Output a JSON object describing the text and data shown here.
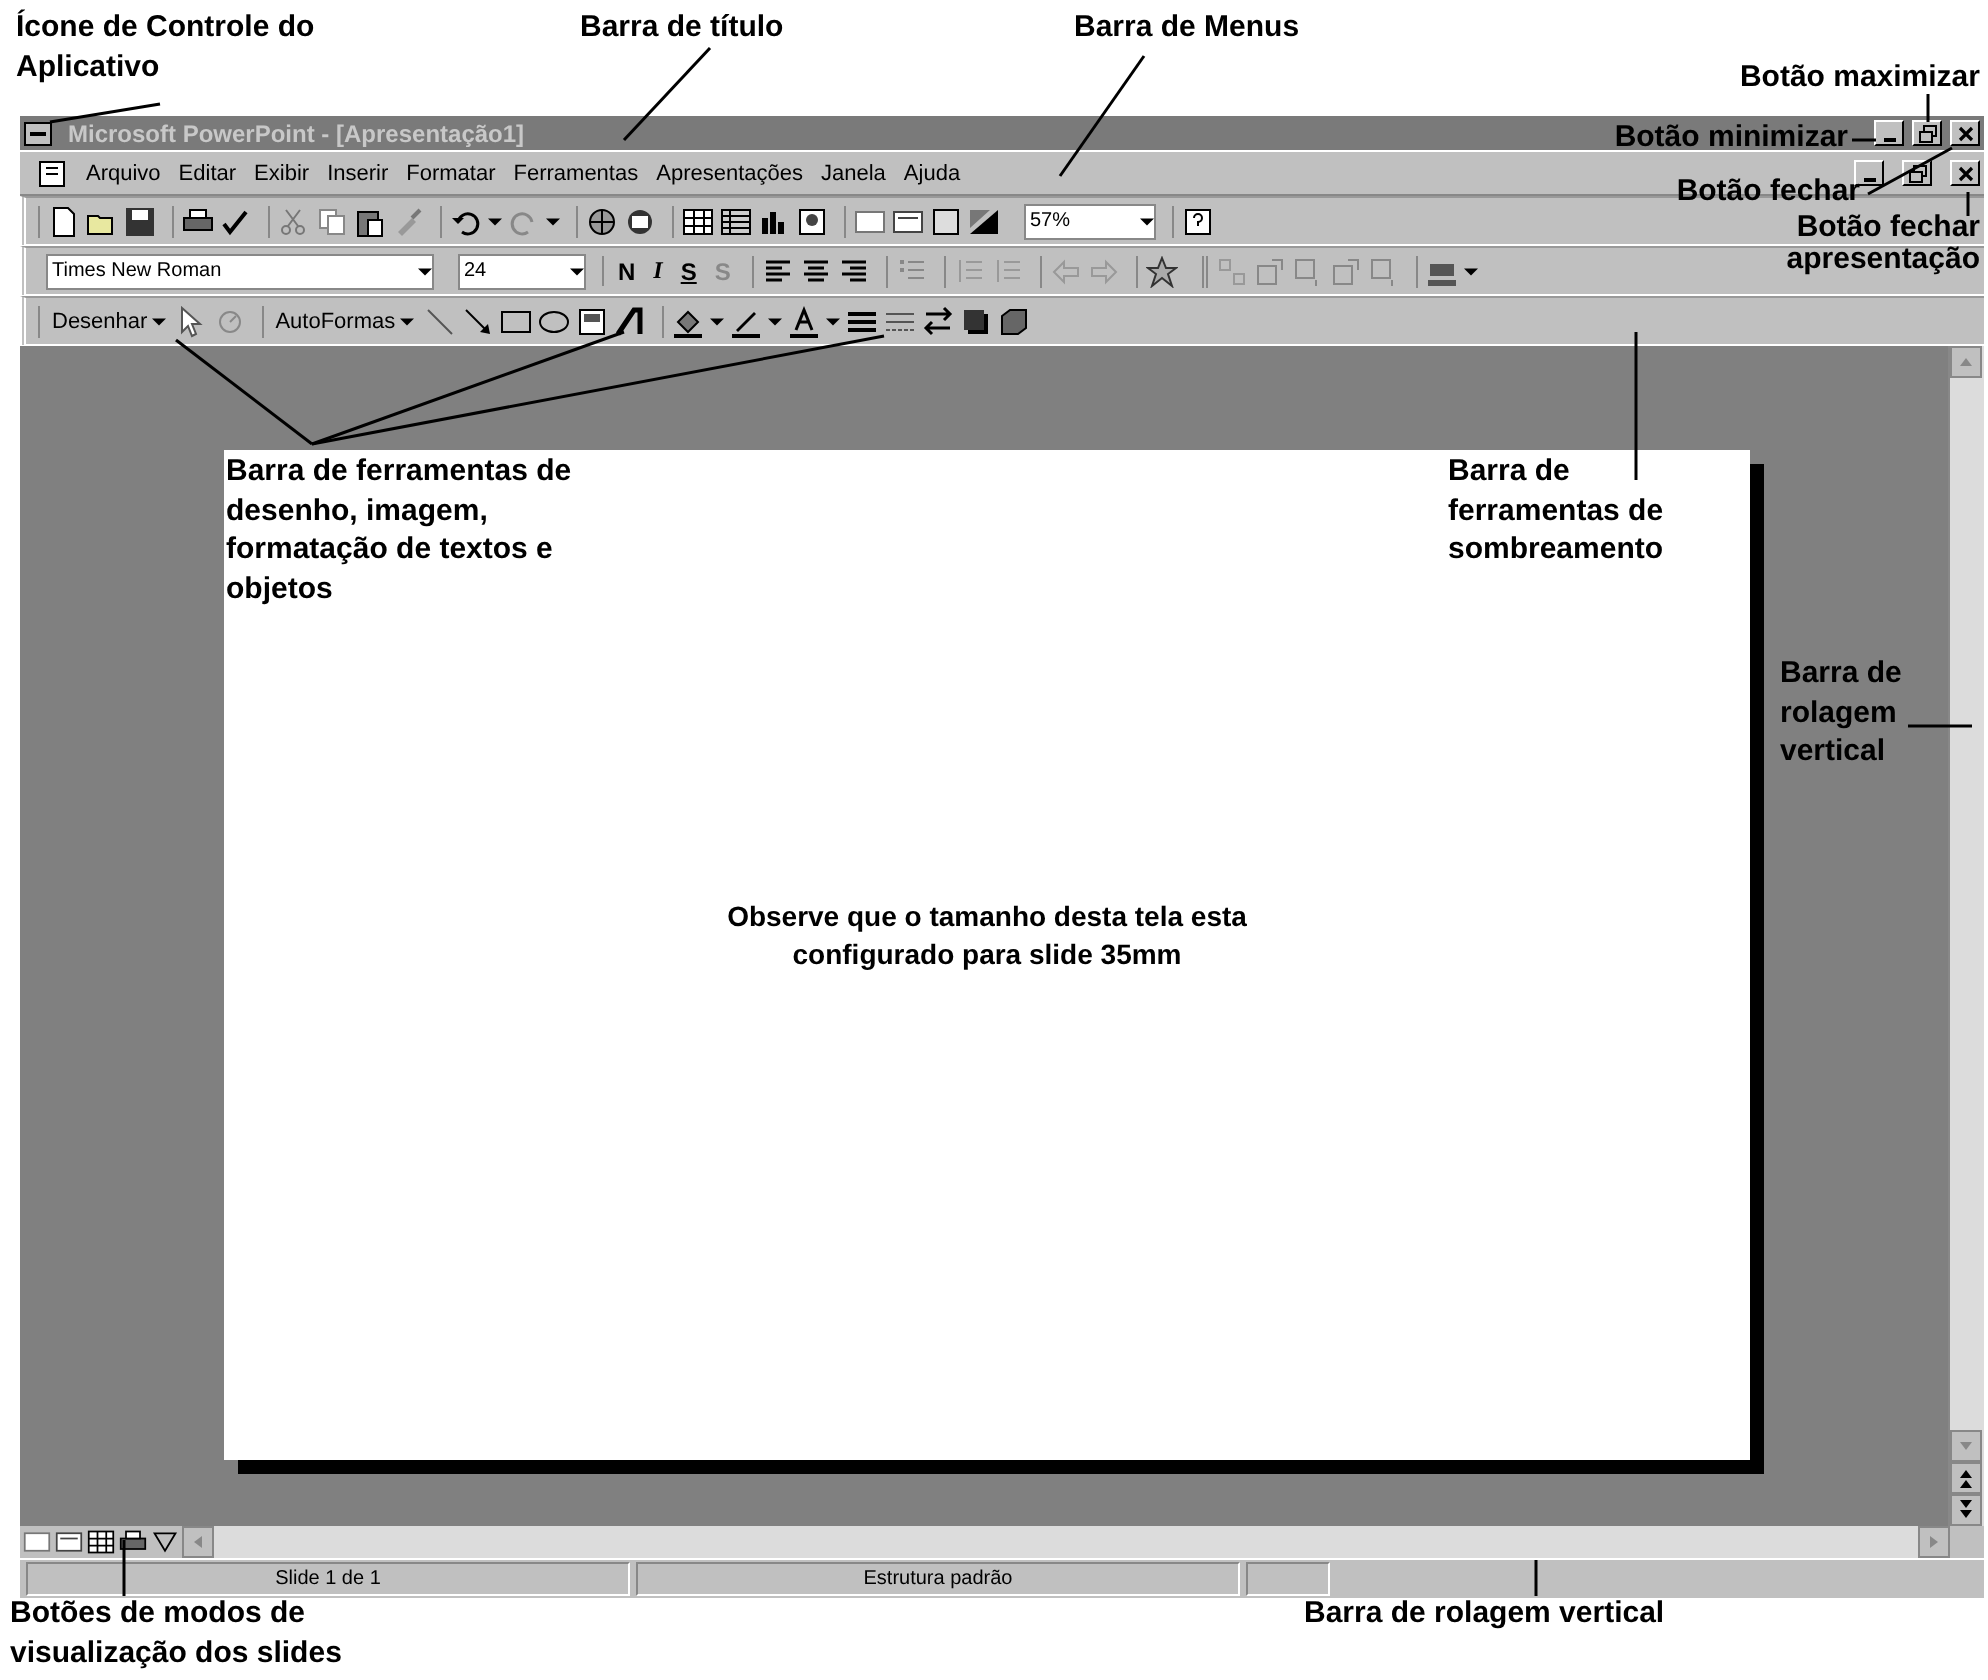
{
  "annotations": [
    {
      "text": "Ícone de Controle do Aplicativo"
    },
    {
      "text": "Barra de título"
    },
    {
      "text": "Barra de Menus"
    },
    {
      "text": "Botão maximizar"
    },
    {
      "text": "Botão minimizar"
    },
    {
      "text": "Botão fechar"
    },
    {
      "text": "Botão fechar apresentação"
    },
    {
      "text": "Barra de ferramentas de desenho, imagem, formatação de textos e objetos"
    },
    {
      "text": "Barra de ferramentas de sombreamento"
    },
    {
      "text": "Barra de rolagem vertical"
    },
    {
      "text": "Botões de modos de visualização dos slides"
    },
    {
      "text": "Barra de rolagem vertical"
    }
  ],
  "window": {
    "title": "Microsoft PowerPoint - [Apresentação1]"
  },
  "menu_bar": {
    "items": [
      "Arquivo",
      "Editar",
      "Exibir",
      "Inserir",
      "Formatar",
      "Ferramentas",
      "Apresentações",
      "Janela",
      "Ajuda"
    ]
  },
  "standard_toolbar": {
    "zoom": "57%"
  },
  "formatting_toolbar": {
    "font": "Times New Roman",
    "size": "24",
    "style_buttons": [
      "N",
      "I",
      "S",
      "S"
    ]
  },
  "drawing_toolbar": {
    "draw_menu": "Desenhar",
    "autoshapes_menu": "AutoFormas"
  },
  "slide": {
    "text": "Observe que o tamanho desta tela esta configurado para slide 35mm"
  },
  "status_bar": {
    "slide": "Slide 1 de 1",
    "design": "Estrutura padrão"
  }
}
